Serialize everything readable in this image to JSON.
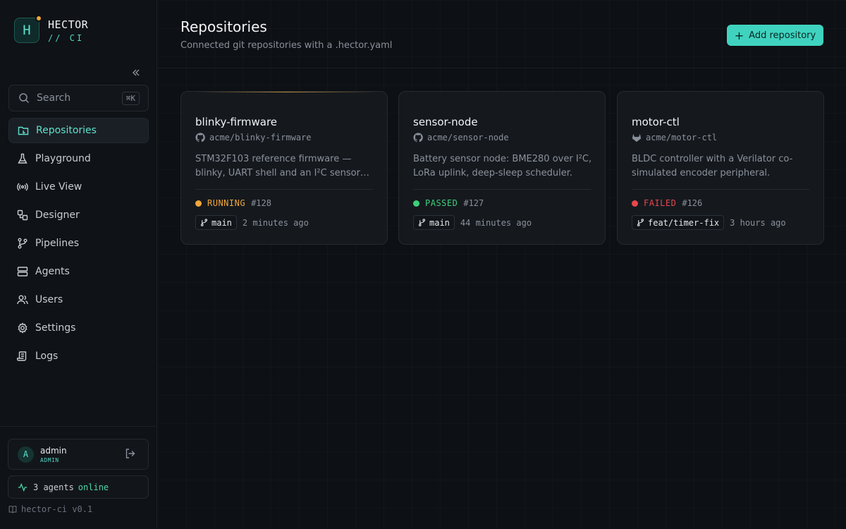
{
  "brand": {
    "logo_letter": "H",
    "name": "HECTOR",
    "sub": "// CI"
  },
  "search": {
    "placeholder": "Search",
    "shortcut": "⌘K"
  },
  "sidebar": {
    "items": [
      {
        "label": "Repositories",
        "icon": "repo-icon",
        "active": true
      },
      {
        "label": "Playground",
        "icon": "flask-icon",
        "active": false
      },
      {
        "label": "Live View",
        "icon": "broadcast-icon",
        "active": false
      },
      {
        "label": "Designer",
        "icon": "designer-icon",
        "active": false
      },
      {
        "label": "Pipelines",
        "icon": "branch-icon",
        "active": false
      },
      {
        "label": "Agents",
        "icon": "server-icon",
        "active": false
      },
      {
        "label": "Users",
        "icon": "users-icon",
        "active": false
      },
      {
        "label": "Settings",
        "icon": "gear-icon",
        "active": false
      },
      {
        "label": "Logs",
        "icon": "scroll-icon",
        "active": false
      }
    ]
  },
  "user": {
    "initial": "A",
    "name": "admin",
    "role": "ADMIN"
  },
  "agents": {
    "count_text": "3 agents",
    "status": "online"
  },
  "version": "hector-ci v0.1",
  "header": {
    "title": "Repositories",
    "subtitle": "Connected git repositories with a .hector.yaml",
    "add_button": "Add repository"
  },
  "colors": {
    "accent": "#3fd3bf",
    "running": "#f0a63a",
    "passed": "#3ecf7a",
    "failed": "#e5484d"
  },
  "repos": [
    {
      "name": "blinky-firmware",
      "path": "acme/blinky-firmware",
      "provider_icon": "github-icon",
      "description": "STM32F103 reference firmware — blinky, UART shell and an I²C sensor…",
      "status": "RUNNING",
      "status_color": "#f0a63a",
      "build": "#128",
      "branch": "main",
      "time": "2 minutes ago"
    },
    {
      "name": "sensor-node",
      "path": "acme/sensor-node",
      "provider_icon": "github-icon",
      "description": "Battery sensor node: BME280 over I²C, LoRa uplink, deep-sleep scheduler.",
      "status": "PASSED",
      "status_color": "#3ecf7a",
      "build": "#127",
      "branch": "main",
      "time": "44 minutes ago"
    },
    {
      "name": "motor-ctl",
      "path": "acme/motor-ctl",
      "provider_icon": "gitlab-icon",
      "description": "BLDC controller with a Verilator co-simulated encoder peripheral.",
      "status": "FAILED",
      "status_color": "#e5484d",
      "build": "#126",
      "branch": "feat/timer-fix",
      "time": "3 hours ago"
    }
  ]
}
